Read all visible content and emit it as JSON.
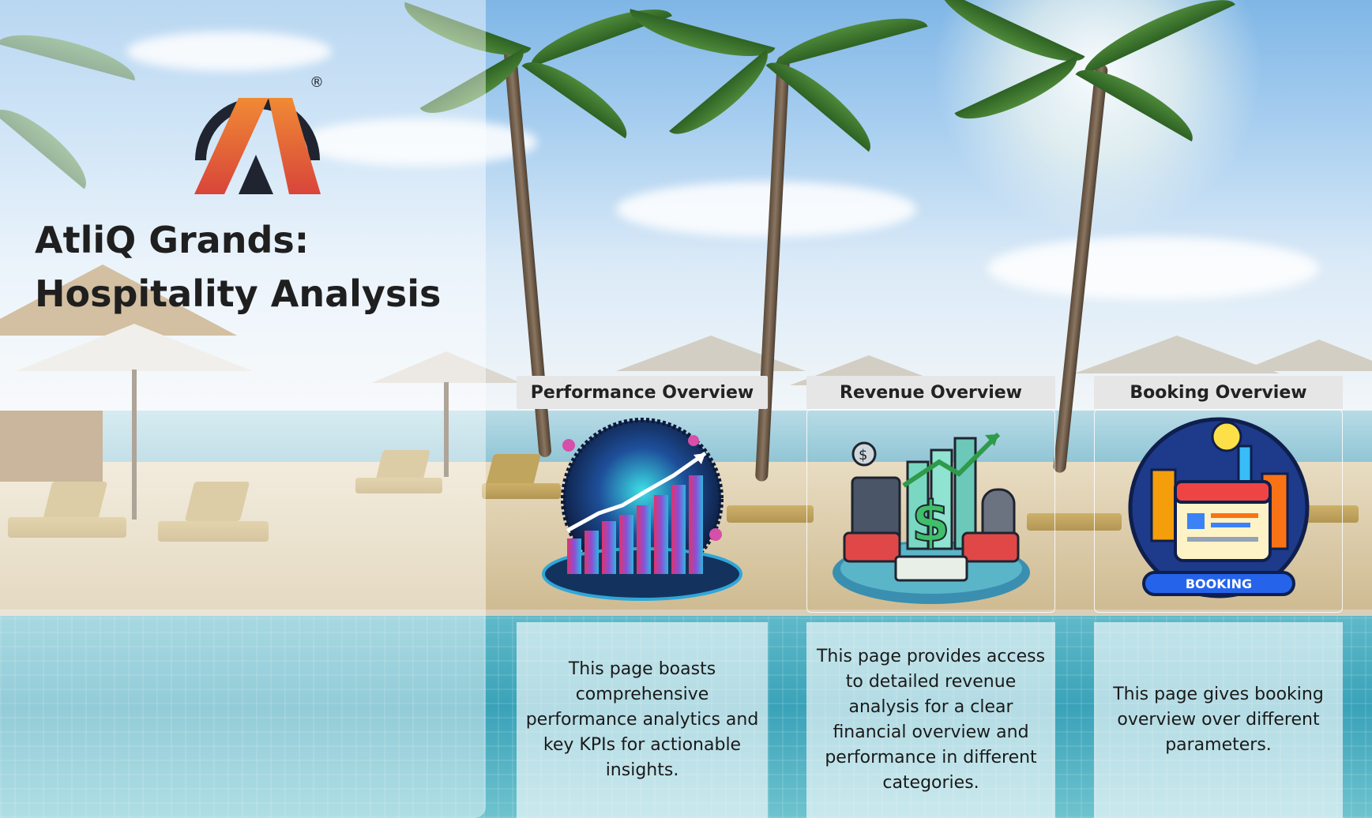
{
  "app": {
    "title_line1": "AtliQ Grands:",
    "title_line2": "Hospitality Analysis",
    "logo_mark": "®"
  },
  "colors": {
    "logo_dark": "#1f2430",
    "logo_orange": "#e8602c",
    "logo_red": "#d84a36",
    "header_bg": "#e6e6e6"
  },
  "cards": [
    {
      "title": "Performance Overview",
      "icon": "performance-chart-illustration",
      "description": "This page boasts comprehensive performance analytics and key KPIs for actionable insights."
    },
    {
      "title": "Revenue Overview",
      "icon": "revenue-money-illustration",
      "description": "This page provides access to detailed revenue analysis for a clear financial overview and performance in different categories."
    },
    {
      "title": "Booking Overview",
      "icon": "booking-calendar-illustration",
      "description": "This page gives booking overview over different parameters.",
      "badge": "BOOKING"
    }
  ]
}
